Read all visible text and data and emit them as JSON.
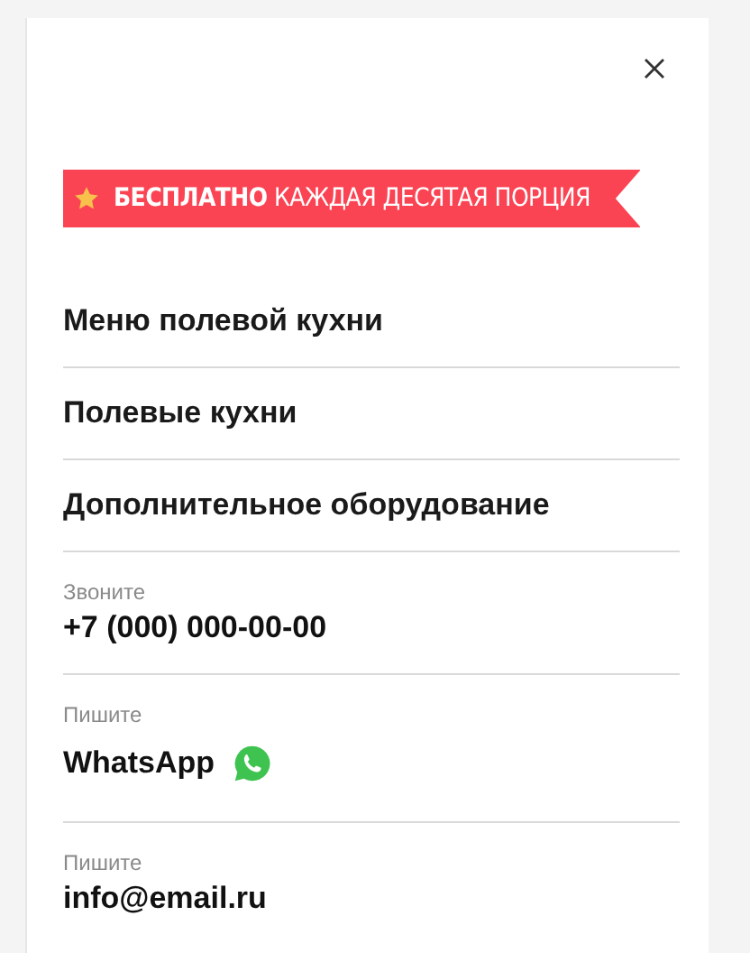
{
  "banner": {
    "text": "**БЕСПЛАТНО** КАЖДАЯ ДЕСЯТАЯ ПОРЦИЯ"
  },
  "menu": [
    {
      "label": "Меню полевой кухни"
    },
    {
      "label": "Полевые кухни"
    },
    {
      "label": "Дополнительное оборудование"
    }
  ],
  "contacts": [
    {
      "kind": "phone",
      "label": "Звоните",
      "value": "+7 (000) 000-00-00"
    },
    {
      "kind": "whatsapp",
      "label": "Пишите",
      "value": "WhatsApp"
    },
    {
      "kind": "email",
      "label": "Пишите",
      "value": "info@email.ru"
    }
  ]
}
